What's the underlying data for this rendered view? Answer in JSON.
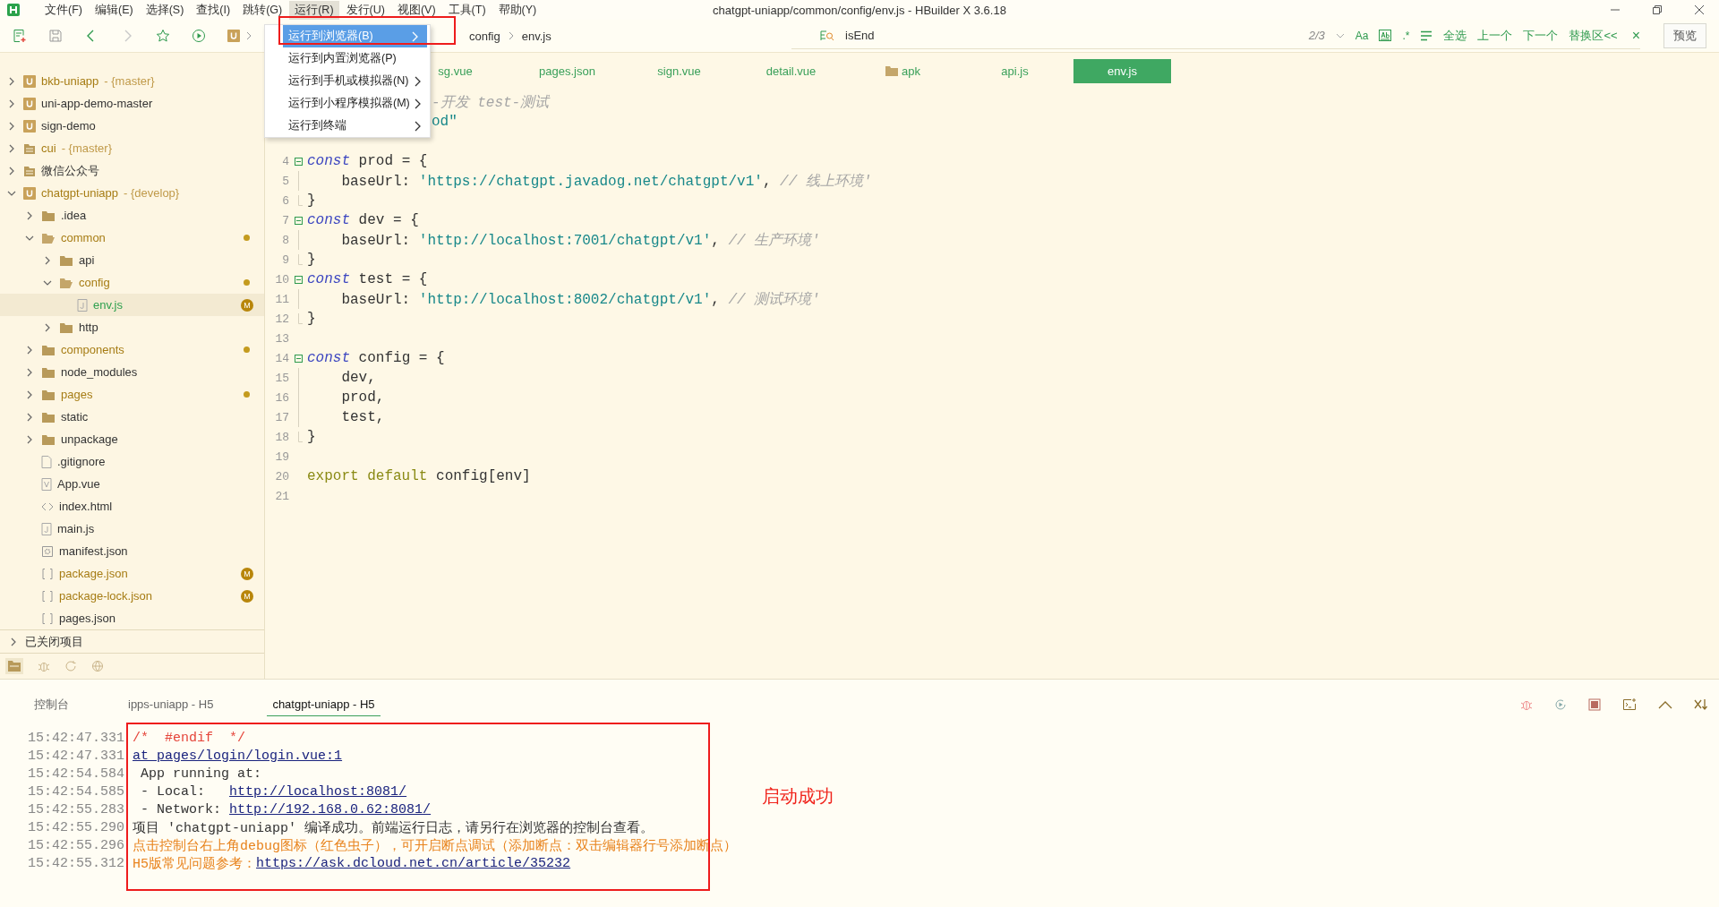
{
  "window": {
    "title": "chatgpt-uniapp/common/config/env.js - HBuilder X 3.6.18",
    "menu": [
      {
        "label": "文件(F)",
        "selected": false
      },
      {
        "label": "编辑(E)",
        "selected": false
      },
      {
        "label": "选择(S)",
        "selected": false
      },
      {
        "label": "查找(I)",
        "selected": false
      },
      {
        "label": "跳转(G)",
        "selected": false
      },
      {
        "label": "运行(R)",
        "selected": true
      },
      {
        "label": "发行(U)",
        "selected": false
      },
      {
        "label": "视图(V)",
        "selected": false
      },
      {
        "label": "工具(T)",
        "selected": false
      },
      {
        "label": "帮助(Y)",
        "selected": false
      }
    ]
  },
  "toolbar": {
    "breadcrumb": [
      "config",
      "env.js"
    ]
  },
  "search": {
    "value": "isEnd",
    "count": "2/3",
    "options": [
      "Aa",
      ".*"
    ],
    "actions": [
      "全选",
      "上一个",
      "下一个",
      "替换区<<"
    ],
    "close": "×",
    "preview": "预览"
  },
  "dropdown": {
    "items": [
      {
        "label": "运行到浏览器(B)",
        "selected": true,
        "submenu": true
      },
      {
        "label": "运行到内置浏览器(P)",
        "selected": false,
        "submenu": false
      },
      {
        "label": "运行到手机或模拟器(N)",
        "selected": false,
        "submenu": true
      },
      {
        "label": "运行到小程序模拟器(M)",
        "selected": false,
        "submenu": true
      },
      {
        "label": "运行到终端",
        "selected": false,
        "submenu": true
      }
    ]
  },
  "sidebar": {
    "tree": [
      {
        "name": "bkb-uniapp",
        "suffix": "- {master}",
        "kind": "project",
        "modified": true,
        "expanded": false,
        "selected": false
      },
      {
        "name": "uni-app-demo-master",
        "kind": "project",
        "modified": false,
        "expanded": false,
        "selected": false
      },
      {
        "name": "sign-demo",
        "kind": "project",
        "modified": false,
        "expanded": false,
        "selected": false
      },
      {
        "name": "cui",
        "suffix": "- {master}",
        "kind": "plain-project",
        "modified": true,
        "expanded": false,
        "selected": false
      },
      {
        "name": "微信公众号",
        "kind": "plain-project",
        "modified": false,
        "expanded": false,
        "selected": false
      },
      {
        "name": "chatgpt-uniapp",
        "suffix": "- {develop}",
        "kind": "project",
        "modified": true,
        "expanded": true,
        "selected": false,
        "children": [
          {
            "name": ".idea",
            "kind": "folder",
            "modified": false,
            "expanded": false,
            "selected": false
          },
          {
            "name": "common",
            "kind": "folder",
            "modified": true,
            "expanded": true,
            "selected": false,
            "dot": true,
            "children": [
              {
                "name": "api",
                "kind": "folder",
                "modified": false,
                "expanded": false,
                "selected": false
              },
              {
                "name": "config",
                "kind": "folder",
                "modified": true,
                "expanded": true,
                "selected": false,
                "dot": true,
                "children": [
                  {
                    "name": "env.js",
                    "kind": "file-js",
                    "selected": true,
                    "badge": "M"
                  }
                ]
              },
              {
                "name": "http",
                "kind": "folder",
                "modified": false,
                "expanded": false,
                "selected": false
              }
            ]
          },
          {
            "name": "components",
            "kind": "folder",
            "modified": true,
            "expanded": false,
            "selected": false,
            "dot": true
          },
          {
            "name": "node_modules",
            "kind": "folder",
            "modified": false,
            "expanded": false,
            "selected": false
          },
          {
            "name": "pages",
            "kind": "folder",
            "modified": true,
            "expanded": false,
            "selected": false,
            "dot": true
          },
          {
            "name": "static",
            "kind": "folder",
            "modified": false,
            "expanded": false,
            "selected": false
          },
          {
            "name": "unpackage",
            "kind": "folder",
            "modified": false,
            "expanded": false,
            "selected": false
          },
          {
            "name": ".gitignore",
            "kind": "file-blank",
            "modified": false,
            "selected": false
          },
          {
            "name": "App.vue",
            "kind": "file-vue",
            "modified": false,
            "selected": false
          },
          {
            "name": "index.html",
            "kind": "file-html",
            "modified": false,
            "selected": false
          },
          {
            "name": "main.js",
            "kind": "file-js",
            "modified": false,
            "selected": false
          },
          {
            "name": "manifest.json",
            "kind": "file-config",
            "modified": false,
            "selected": false
          },
          {
            "name": "package.json",
            "kind": "file-json",
            "modified": true,
            "selected": false,
            "badge": "M"
          },
          {
            "name": "package-lock.json",
            "kind": "file-json",
            "modified": true,
            "selected": false,
            "badge": "M"
          },
          {
            "name": "pages.json",
            "kind": "file-json",
            "modified": false,
            "selected": false
          }
        ]
      }
    ],
    "closed_projects": "已关闭项目"
  },
  "tabs": [
    {
      "label": "sg.vue",
      "kind": "file",
      "selected": false
    },
    {
      "label": "pages.json",
      "kind": "file",
      "selected": false
    },
    {
      "label": "sign.vue",
      "kind": "file",
      "selected": false
    },
    {
      "label": "detail.vue",
      "kind": "file",
      "selected": false
    },
    {
      "label": "apk",
      "kind": "folder",
      "selected": false
    },
    {
      "label": "api.js",
      "kind": "file",
      "selected": false
    },
    {
      "label": "env.js",
      "kind": "file",
      "selected": true
    }
  ],
  "editor": {
    "lines": [
      {
        "kind": "covered",
        "partial": true,
        "tokens": [
          {
            "kind": "comment",
            "s": "-开发 test-测试"
          }
        ]
      },
      {
        "kind": "covered",
        "partial": true,
        "tokens": [
          {
            "kind": "string",
            "s": "od\""
          }
        ]
      },
      {
        "kind": "covered"
      },
      {
        "number": "4",
        "kind": "block-start",
        "tokens": [
          {
            "kind": "keyword",
            "s": "const"
          },
          {
            "kind": "plain",
            "s": " prod = {"
          }
        ]
      },
      {
        "number": "5",
        "kind": "block-body",
        "tokens": [
          {
            "kind": "plain",
            "s": "    baseUrl: "
          },
          {
            "kind": "string",
            "s": "'https://chatgpt.javadog.net/chatgpt/v1'"
          },
          {
            "kind": "plain",
            "s": ", "
          },
          {
            "kind": "comment",
            "s": "// 线上环境'"
          }
        ]
      },
      {
        "number": "6",
        "kind": "block-end",
        "tokens": [
          {
            "kind": "plain",
            "s": "}"
          }
        ]
      },
      {
        "number": "7",
        "kind": "block-start",
        "tokens": [
          {
            "kind": "keyword",
            "s": "const"
          },
          {
            "kind": "plain",
            "s": " dev = {"
          }
        ]
      },
      {
        "number": "8",
        "kind": "block-body",
        "tokens": [
          {
            "kind": "plain",
            "s": "    baseUrl: "
          },
          {
            "kind": "string",
            "s": "'http://localhost:7001/chatgpt/v1'"
          },
          {
            "kind": "plain",
            "s": ", "
          },
          {
            "kind": "comment",
            "s": "// 生产环境'"
          }
        ]
      },
      {
        "number": "9",
        "kind": "block-end",
        "tokens": [
          {
            "kind": "plain",
            "s": "}"
          }
        ]
      },
      {
        "number": "10",
        "kind": "block-start",
        "tokens": [
          {
            "kind": "keyword",
            "s": "const"
          },
          {
            "kind": "plain",
            "s": " test = {"
          }
        ]
      },
      {
        "number": "11",
        "kind": "block-body",
        "tokens": [
          {
            "kind": "plain",
            "s": "    baseUrl: "
          },
          {
            "kind": "string",
            "s": "'http://localhost:8002/chatgpt/v1'"
          },
          {
            "kind": "plain",
            "s": ", "
          },
          {
            "kind": "comment",
            "s": "// 测试环境'"
          }
        ]
      },
      {
        "number": "12",
        "kind": "block-end",
        "tokens": [
          {
            "kind": "plain",
            "s": "}"
          }
        ]
      },
      {
        "number": "13",
        "kind": "plain"
      },
      {
        "number": "14",
        "kind": "block-start",
        "tokens": [
          {
            "kind": "keyword",
            "s": "const"
          },
          {
            "kind": "plain",
            "s": " config = {"
          }
        ]
      },
      {
        "number": "15",
        "kind": "block-body",
        "tokens": [
          {
            "kind": "plain",
            "s": "    dev,"
          }
        ]
      },
      {
        "number": "16",
        "kind": "block-body",
        "tokens": [
          {
            "kind": "plain",
            "s": "    prod,"
          }
        ]
      },
      {
        "number": "17",
        "kind": "block-body",
        "tokens": [
          {
            "kind": "plain",
            "s": "    test,"
          }
        ]
      },
      {
        "number": "18",
        "kind": "block-end",
        "tokens": [
          {
            "kind": "plain",
            "s": "}"
          }
        ]
      },
      {
        "number": "19",
        "kind": "plain"
      },
      {
        "number": "20",
        "kind": "plain",
        "tokens": [
          {
            "kind": "export",
            "s": "export default"
          },
          {
            "kind": "plain",
            "s": " config[env]"
          }
        ]
      },
      {
        "number": "21",
        "kind": "plain"
      }
    ]
  },
  "console": {
    "tabs": [
      {
        "label": "控制台",
        "selected": false
      },
      {
        "label": "ipps-uniapp - H5",
        "selected": false
      },
      {
        "label": "chatgpt-uniapp - H5",
        "selected": true
      }
    ],
    "lines": [
      {
        "time": "15:42:47.331",
        "segments": [
          {
            "kind": "error",
            "text": "/*  #endif  */"
          }
        ]
      },
      {
        "time": "15:42:47.331",
        "segments": [
          {
            "kind": "link",
            "text": "at pages/login/login.vue:1"
          }
        ]
      },
      {
        "time": "15:42:54.584",
        "segments": [
          {
            "kind": "plain",
            "text": " App running at:"
          }
        ]
      },
      {
        "time": "15:42:54.585",
        "segments": [
          {
            "kind": "plain",
            "text": " - Local:   "
          },
          {
            "kind": "link",
            "text": "http://localhost:8081/"
          }
        ]
      },
      {
        "time": "15:42:55.283",
        "segments": [
          {
            "kind": "plain",
            "text": " - Network: "
          },
          {
            "kind": "link",
            "text": "http://192.168.0.62:8081/"
          }
        ]
      },
      {
        "time": "15:42:55.290",
        "segments": [
          {
            "kind": "plain",
            "text": "项目 'chatgpt-uniapp' 编译成功。前端运行日志，请另行在浏览器的控制台查看。"
          }
        ]
      },
      {
        "time": "15:42:55.296",
        "segments": [
          {
            "kind": "warn",
            "text": "点击控制台右上角debug图标（红色虫子），可开启断点调试（添加断点：双击编辑器行号添加断点）"
          }
        ]
      },
      {
        "time": "15:42:55.312",
        "segments": [
          {
            "kind": "warn",
            "text": "H5版常见问题参考："
          },
          {
            "kind": "link",
            "text": "https://ask.dcloud.net.cn/article/35232"
          }
        ]
      }
    ],
    "annotation": "启动成功"
  }
}
